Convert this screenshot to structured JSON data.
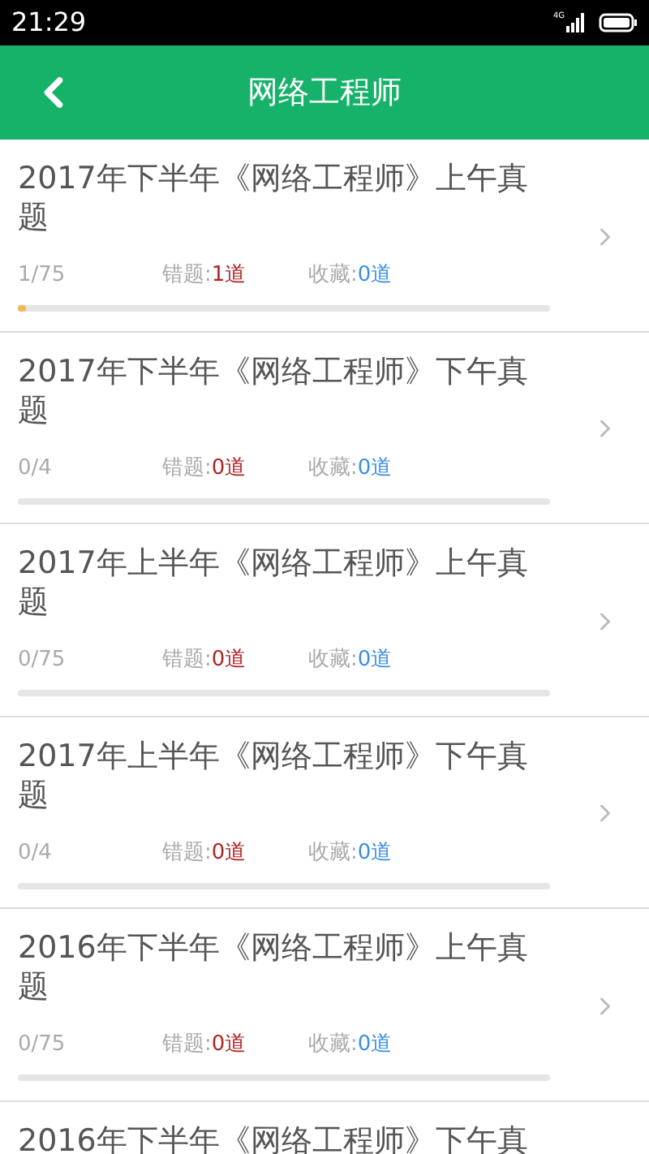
{
  "status_bar": {
    "time": "21:29",
    "network": "4G"
  },
  "header": {
    "title": "网络工程师"
  },
  "items": [
    {
      "title": "2017年下半年《网络工程师》上午真题",
      "progress": "1/75",
      "level": 0.0133,
      "wrong_label": "错题:",
      "wrong_count": "1道",
      "fav_label": "收藏:",
      "fav_count": "0道"
    },
    {
      "title": "2017年下半年《网络工程师》下午真题",
      "progress": "0/4",
      "level": 0,
      "wrong_label": "错题:",
      "wrong_count": "0道",
      "fav_label": "收藏:",
      "fav_count": "0道"
    },
    {
      "title": "2017年上半年《网络工程师》上午真题",
      "progress": "0/75",
      "level": 0,
      "wrong_label": "错题:",
      "wrong_count": "0道",
      "fav_label": "收藏:",
      "fav_count": "0道"
    },
    {
      "title": "2017年上半年《网络工程师》下午真题",
      "progress": "0/4",
      "level": 0,
      "wrong_label": "错题:",
      "wrong_count": "0道",
      "fav_label": "收藏:",
      "fav_count": "0道"
    },
    {
      "title": "2016年下半年《网络工程师》上午真题",
      "progress": "0/75",
      "level": 0,
      "wrong_label": "错题:",
      "wrong_count": "0道",
      "fav_label": "收藏:",
      "fav_count": "0道"
    },
    {
      "title": "2016年下半年《网络工程师》下午真"
    }
  ]
}
